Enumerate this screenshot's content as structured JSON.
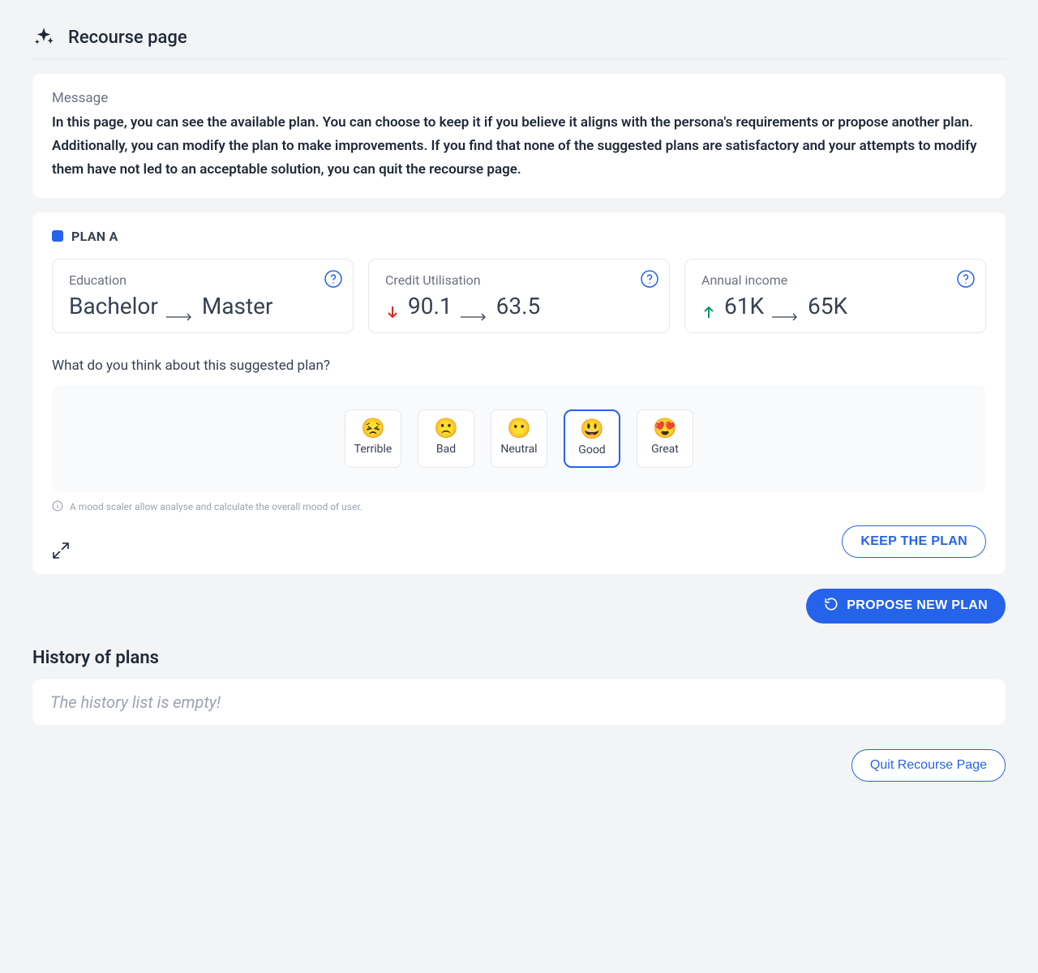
{
  "header": {
    "title": "Recourse page"
  },
  "message": {
    "label": "Message",
    "body": "In this page, you can see the available plan. You can choose to keep it if you believe it aligns with the persona's requirements or propose another plan. Additionally, you can modify the plan to make improvements. If you find that none of the suggested plans are satisfactory and your attempts to modify them have not led to an acceptable solution, you can quit the recourse page."
  },
  "plan": {
    "label": "PLAN A",
    "features": [
      {
        "title": "Education",
        "from": "Bachelor",
        "to": "Master",
        "trend": "none"
      },
      {
        "title": "Credit Utilisation",
        "from": "90.1",
        "to": "63.5",
        "trend": "down"
      },
      {
        "title": "Annual income",
        "from": "61K",
        "to": "65K",
        "trend": "up"
      }
    ]
  },
  "feedback": {
    "question": "What do you think about this suggested plan?",
    "options": [
      {
        "label": "Terrible",
        "emoji": "😣"
      },
      {
        "label": "Bad",
        "emoji": "🙁"
      },
      {
        "label": "Neutral",
        "emoji": "😶"
      },
      {
        "label": "Good",
        "emoji": "😃"
      },
      {
        "label": "Great",
        "emoji": "😍"
      }
    ],
    "selected_index": 3,
    "hint": "A mood scaler allow analyse and calculate the overall mood of user."
  },
  "actions": {
    "keep": "KEEP THE PLAN",
    "propose": "PROPOSE NEW PLAN",
    "quit": "Quit Recourse Page"
  },
  "history": {
    "title": "History of plans",
    "empty_text": "The history list is empty!"
  }
}
